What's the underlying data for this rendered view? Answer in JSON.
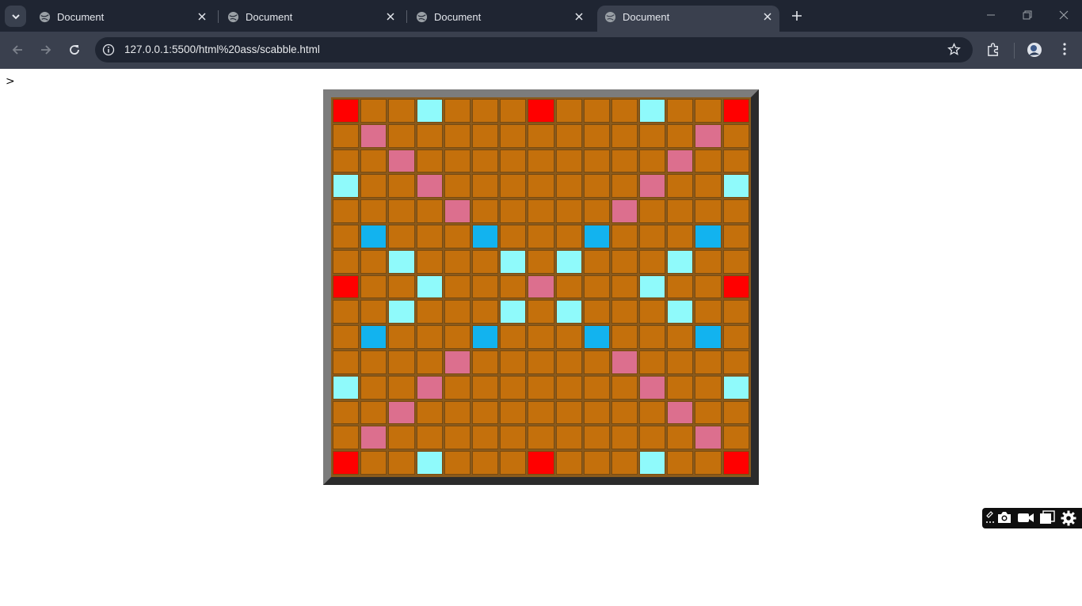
{
  "browser": {
    "tabs": [
      {
        "title": "Document",
        "active": false
      },
      {
        "title": "Document",
        "active": false
      },
      {
        "title": "Document",
        "active": false
      },
      {
        "title": "Document",
        "active": true
      }
    ],
    "url": "127.0.0.1:5500/html%20ass/scabble.html"
  },
  "page": {
    "prompt_text": ">"
  },
  "board": {
    "size": 15,
    "legend": {
      "tw": "#ff0000",
      "dw": "#dc6f8e",
      "tl": "#12b3ef",
      "dl": "#8ffafb",
      "n": "#c4700c"
    },
    "rows": [
      [
        "tw",
        "n",
        "n",
        "dl",
        "n",
        "n",
        "n",
        "tw",
        "n",
        "n",
        "n",
        "dl",
        "n",
        "n",
        "tw"
      ],
      [
        "n",
        "dw",
        "n",
        "n",
        "n",
        "n",
        "n",
        "n",
        "n",
        "n",
        "n",
        "n",
        "n",
        "dw",
        "n"
      ],
      [
        "n",
        "n",
        "dw",
        "n",
        "n",
        "n",
        "n",
        "n",
        "n",
        "n",
        "n",
        "n",
        "dw",
        "n",
        "n"
      ],
      [
        "dl",
        "n",
        "n",
        "dw",
        "n",
        "n",
        "n",
        "n",
        "n",
        "n",
        "n",
        "dw",
        "n",
        "n",
        "dl"
      ],
      [
        "n",
        "n",
        "n",
        "n",
        "dw",
        "n",
        "n",
        "n",
        "n",
        "n",
        "dw",
        "n",
        "n",
        "n",
        "n"
      ],
      [
        "n",
        "tl",
        "n",
        "n",
        "n",
        "tl",
        "n",
        "n",
        "n",
        "tl",
        "n",
        "n",
        "n",
        "tl",
        "n"
      ],
      [
        "n",
        "n",
        "dl",
        "n",
        "n",
        "n",
        "dl",
        "n",
        "dl",
        "n",
        "n",
        "n",
        "dl",
        "n",
        "n"
      ],
      [
        "tw",
        "n",
        "n",
        "dl",
        "n",
        "n",
        "n",
        "dw",
        "n",
        "n",
        "n",
        "dl",
        "n",
        "n",
        "tw"
      ],
      [
        "n",
        "n",
        "dl",
        "n",
        "n",
        "n",
        "dl",
        "n",
        "dl",
        "n",
        "n",
        "n",
        "dl",
        "n",
        "n"
      ],
      [
        "n",
        "tl",
        "n",
        "n",
        "n",
        "tl",
        "n",
        "n",
        "n",
        "tl",
        "n",
        "n",
        "n",
        "tl",
        "n"
      ],
      [
        "n",
        "n",
        "n",
        "n",
        "dw",
        "n",
        "n",
        "n",
        "n",
        "n",
        "dw",
        "n",
        "n",
        "n",
        "n"
      ],
      [
        "dl",
        "n",
        "n",
        "dw",
        "n",
        "n",
        "n",
        "n",
        "n",
        "n",
        "n",
        "dw",
        "n",
        "n",
        "dl"
      ],
      [
        "n",
        "n",
        "dw",
        "n",
        "n",
        "n",
        "n",
        "n",
        "n",
        "n",
        "n",
        "n",
        "dw",
        "n",
        "n"
      ],
      [
        "n",
        "dw",
        "n",
        "n",
        "n",
        "n",
        "n",
        "n",
        "n",
        "n",
        "n",
        "n",
        "n",
        "dw",
        "n"
      ],
      [
        "tw",
        "n",
        "n",
        "dl",
        "n",
        "n",
        "n",
        "tw",
        "n",
        "n",
        "n",
        "dl",
        "n",
        "n",
        "tw"
      ]
    ]
  }
}
